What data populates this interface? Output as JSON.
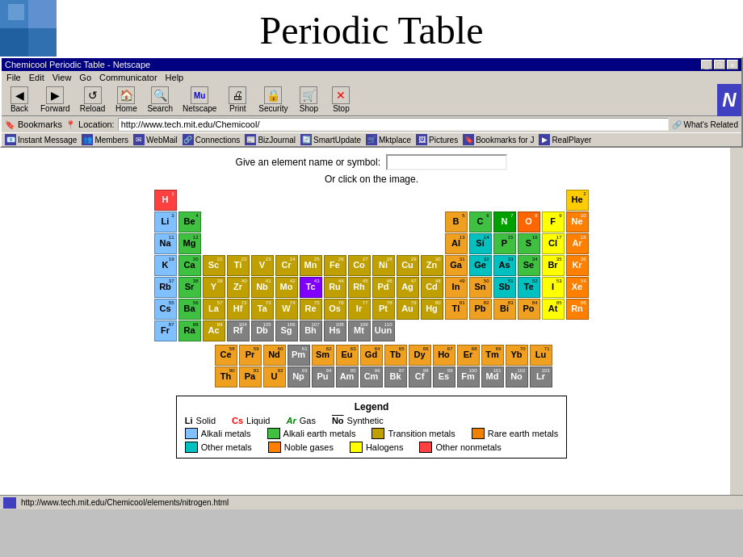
{
  "title": "Periodic Table",
  "browser": {
    "title": "Chemicool Periodic Table - Netscape",
    "location": "http://www.tech.mit.edu/Chemicool/",
    "menu": [
      "File",
      "Edit",
      "View",
      "Go",
      "Communicator",
      "Help"
    ],
    "toolbar": [
      "Back",
      "Forward",
      "Reload",
      "Home",
      "Search",
      "Netscape",
      "Print",
      "Security",
      "Shop",
      "Stop"
    ],
    "bookmarks": [
      "Bookmarks",
      "Instant Message",
      "Members",
      "WebMail",
      "Connections",
      "BizJournal",
      "SmartUpdate",
      "Mktplace",
      "Pictures",
      "Bookmarks for J",
      "RealPlayer"
    ],
    "whats_related": "What's Related"
  },
  "page": {
    "search_label": "Give an element name or symbol:",
    "click_msg": "Or click on the image."
  },
  "legend": {
    "title": "Legend",
    "states": [
      {
        "label": "Li",
        "type": "solid",
        "desc": "Solid"
      },
      {
        "label": "Cs",
        "type": "liquid",
        "desc": "Liquid"
      },
      {
        "label": "Ar",
        "type": "gas",
        "desc": "Gas"
      },
      {
        "label": "No",
        "type": "synthetic",
        "desc": "Synthetic"
      }
    ],
    "categories": [
      {
        "color": "#80c0ff",
        "label": "Alkali metals"
      },
      {
        "color": "#40c040",
        "label": "Alkali earth metals"
      },
      {
        "color": "#c0a000",
        "label": "Transition metals"
      },
      {
        "color": "#f08000",
        "label": "Rare earth metals"
      },
      {
        "color": "#00c0c0",
        "label": "Other metals"
      },
      {
        "color": "#ff8000",
        "label": "Noble gases"
      },
      {
        "color": "#ffff00",
        "label": "Halogens"
      },
      {
        "color": "#ff4040",
        "label": "Other nonmetals"
      }
    ]
  },
  "status": {
    "url": "http://www.tech.mit.edu/Chemicool/elements/nitrogen.html"
  }
}
